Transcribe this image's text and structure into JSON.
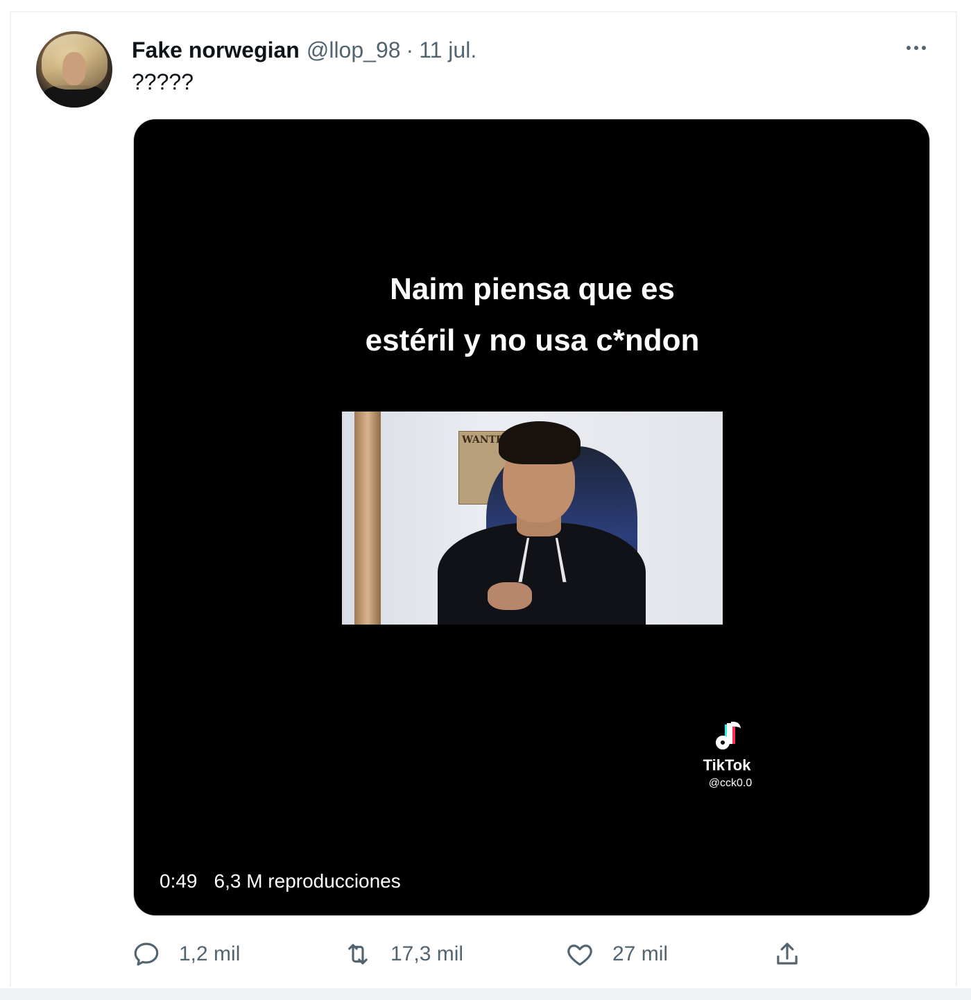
{
  "tweet": {
    "author_name": "Fake norwegian",
    "handle": "@llop_98",
    "separator": "·",
    "date": "11 jul.",
    "text": "?????"
  },
  "media": {
    "caption_line1": "Naim piensa que es",
    "caption_line2": "estéril y no usa c*ndon",
    "poster_text": "WANTED",
    "tiktok_brand": "TikTok",
    "tiktok_user": "@cck0.0",
    "duration": "0:49",
    "views": "6,3 M reproducciones"
  },
  "actions": {
    "replies": "1,2 mil",
    "retweets": "17,3 mil",
    "likes": "27 mil"
  },
  "icons": {
    "reply": "reply-icon",
    "retweet": "retweet-icon",
    "like": "heart-icon",
    "share": "share-icon",
    "more": "more-icon"
  },
  "colors": {
    "text_primary": "#0f1419",
    "text_secondary": "#536471",
    "media_background": "#000000"
  }
}
